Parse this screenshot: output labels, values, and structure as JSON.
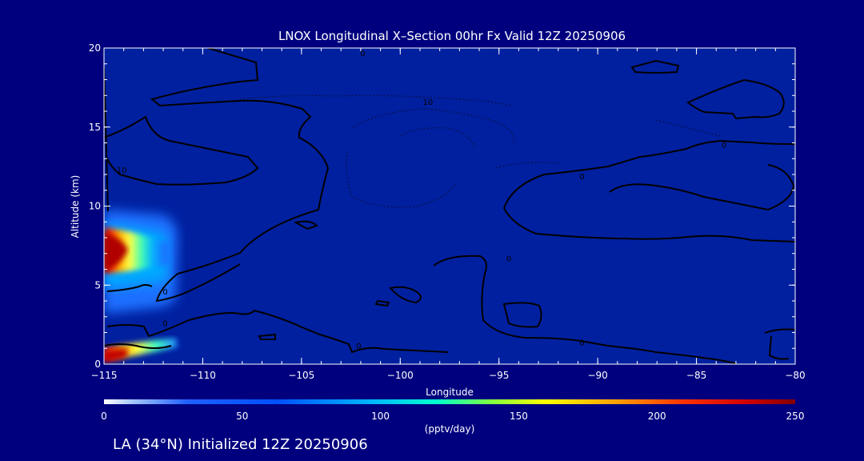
{
  "chart_data": {
    "type": "heatmap",
    "title": "LNOX Longitudinal X–Section 00hr  Fx Valid 12Z 20250906",
    "xlabel": "Longitude",
    "ylabel": "Altitude (km)",
    "xlim": [
      -115,
      -80
    ],
    "ylim": [
      0,
      20
    ],
    "x_ticks": [
      "−115",
      "−110",
      "−105",
      "−100",
      "−95",
      "−90",
      "−85",
      "−80"
    ],
    "y_ticks": [
      "0",
      "5",
      "10",
      "15",
      "20"
    ],
    "colorbar": {
      "label": "(pptv/day)",
      "min": 0,
      "max": 250,
      "ticks": [
        "0",
        "50",
        "100",
        "150",
        "200",
        "250"
      ]
    },
    "contour_labels": [
      {
        "text": "0",
        "lon": -101.9,
        "alt": 19.7
      },
      {
        "text": "10",
        "lon": -98.6,
        "alt": 16.6
      },
      {
        "text": "0",
        "lon": -83.6,
        "alt": 13.9
      },
      {
        "text": "10",
        "lon": -114.1,
        "alt": 12.3
      },
      {
        "text": "0",
        "lon": -90.8,
        "alt": 11.9
      },
      {
        "text": "0",
        "lon": -94.5,
        "alt": 6.7
      },
      {
        "text": "0",
        "lon": -111.9,
        "alt": 4.6
      },
      {
        "text": "0",
        "lon": -111.9,
        "alt": 2.6
      },
      {
        "text": "0",
        "lon": -102.1,
        "alt": 1.2
      },
      {
        "text": "0",
        "lon": -90.8,
        "alt": 1.4
      }
    ],
    "features": [
      {
        "note": "high LNOX core",
        "lon_range": [
          -115,
          -112
        ],
        "alt_range": [
          6,
          8.5
        ],
        "peak": 250
      },
      {
        "note": "low LNOX band",
        "lon_range": [
          -115,
          -112
        ],
        "alt_range": [
          0.5,
          1.5
        ],
        "peak": 250
      }
    ]
  },
  "footer": {
    "text": "LA (34°N) Initialized 12Z 20250906"
  },
  "colors": {
    "background": "#00007f",
    "field_low": "#0020a0",
    "contour": "#000000"
  }
}
